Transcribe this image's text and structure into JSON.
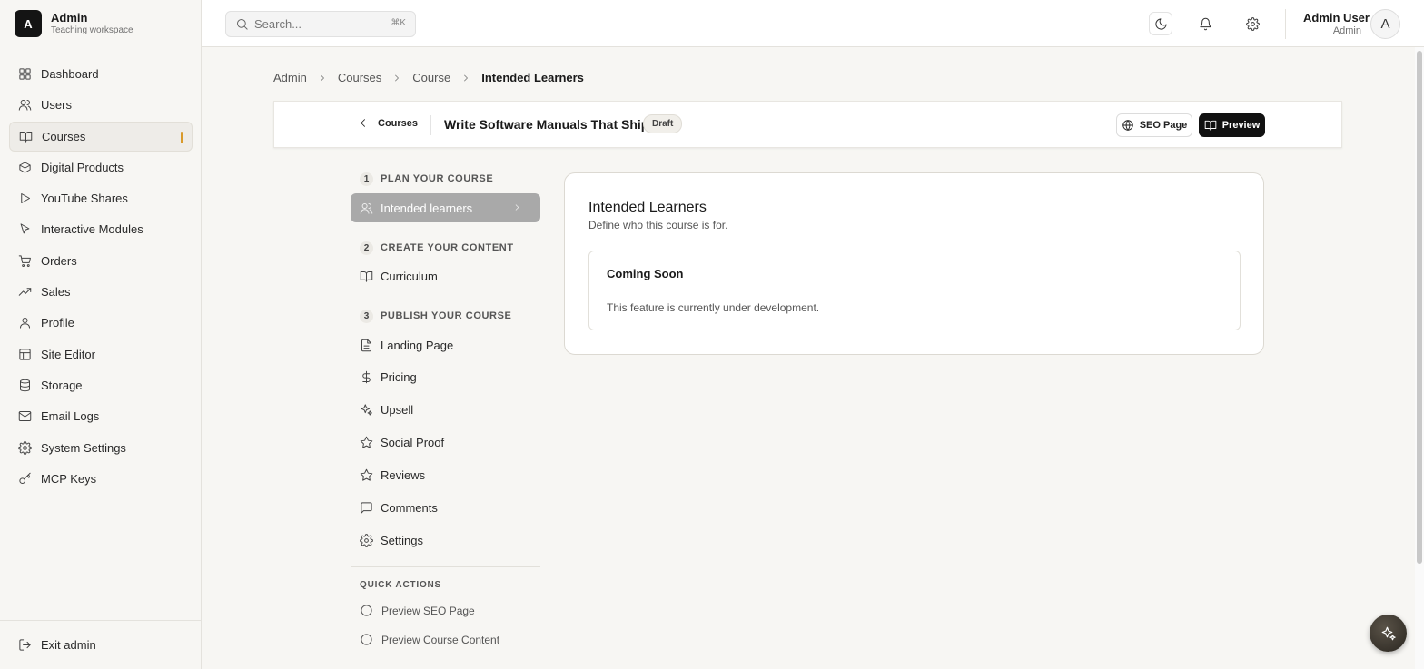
{
  "brand": {
    "logo_letter": "A",
    "name": "Admin",
    "subtitle": "Teaching workspace"
  },
  "sidebar": {
    "items": [
      {
        "label": "Dashboard",
        "icon": "grid-icon"
      },
      {
        "label": "Users",
        "icon": "users-icon"
      },
      {
        "label": "Courses",
        "icon": "book-icon",
        "active": true
      },
      {
        "label": "Digital Products",
        "icon": "package-icon"
      },
      {
        "label": "YouTube Shares",
        "icon": "play-icon"
      },
      {
        "label": "Interactive Modules",
        "icon": "cursor-icon"
      },
      {
        "label": "Orders",
        "icon": "cart-icon"
      },
      {
        "label": "Sales",
        "icon": "trending-up-icon"
      },
      {
        "label": "Profile",
        "icon": "user-icon"
      },
      {
        "label": "Site Editor",
        "icon": "layout-icon"
      },
      {
        "label": "Storage",
        "icon": "database-icon"
      },
      {
        "label": "Email Logs",
        "icon": "mail-icon"
      },
      {
        "label": "System Settings",
        "icon": "gear-icon"
      },
      {
        "label": "MCP Keys",
        "icon": "key-icon"
      }
    ],
    "exit_label": "Exit admin"
  },
  "topbar": {
    "search_placeholder": "Search...",
    "search_shortcut": "⌘K",
    "user_name": "Admin User",
    "user_role": "Admin",
    "avatar_letter": "A"
  },
  "breadcrumb": [
    "Admin",
    "Courses",
    "Course",
    "Intended Learners"
  ],
  "course_header": {
    "back_label": "Courses",
    "title": "Write Software Manuals That Ship",
    "status": "Draft",
    "seo_label": "SEO Page",
    "preview_label": "Preview"
  },
  "course_nav": {
    "sections": [
      {
        "number": "1",
        "title": "PLAN YOUR COURSE",
        "items": [
          {
            "label": "Intended learners",
            "icon": "users-icon",
            "active": true
          }
        ]
      },
      {
        "number": "2",
        "title": "CREATE YOUR CONTENT",
        "items": [
          {
            "label": "Curriculum",
            "icon": "book-icon"
          }
        ]
      },
      {
        "number": "3",
        "title": "PUBLISH YOUR COURSE",
        "items": [
          {
            "label": "Landing Page",
            "icon": "file-icon"
          },
          {
            "label": "Pricing",
            "icon": "dollar-icon"
          },
          {
            "label": "Upsell",
            "icon": "sparkles-icon"
          },
          {
            "label": "Social Proof",
            "icon": "star-icon"
          },
          {
            "label": "Reviews",
            "icon": "star-icon"
          },
          {
            "label": "Comments",
            "icon": "message-icon"
          },
          {
            "label": "Settings",
            "icon": "gear-icon"
          }
        ]
      }
    ],
    "quick_actions_title": "QUICK ACTIONS",
    "quick_actions": [
      "Preview SEO Page",
      "Preview Course Content"
    ]
  },
  "main": {
    "title": "Intended Learners",
    "subtitle": "Define who this course is for.",
    "card_title": "Coming Soon",
    "card_text": "This feature is currently under development."
  }
}
